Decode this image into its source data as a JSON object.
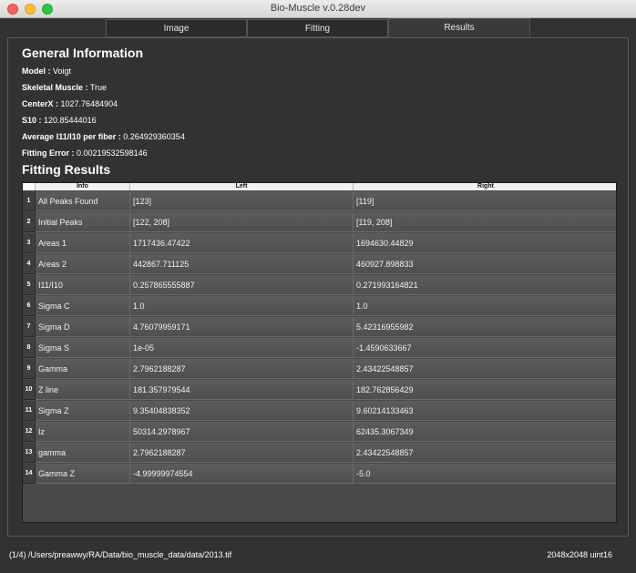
{
  "window": {
    "title": "Bio-Muscle v.0.28dev"
  },
  "tabs": [
    {
      "label": "Image"
    },
    {
      "label": "Fitting"
    },
    {
      "label": "Results"
    }
  ],
  "general": {
    "heading": "General Information",
    "model_label": "Model :",
    "model_value": "Voigt",
    "skeletal_label": "Skeletal Muscle :",
    "skeletal_value": "True",
    "centerx_label": "CenterX :",
    "centerx_value": "1027.76484904",
    "s10_label": "S10 :",
    "s10_value": "120.85444016",
    "avg_label": "Average I11/I10 per fiber :",
    "avg_value": "0.264929360354",
    "error_label": "Fitting Error :",
    "error_value": "0.00219532598146"
  },
  "fitting": {
    "heading": "Fitting Results",
    "columns": [
      "Info",
      "Left",
      "Right"
    ],
    "rows": [
      {
        "n": "1",
        "info": "All Peaks Found",
        "left": "[123]",
        "right": "[119]"
      },
      {
        "n": "2",
        "info": "Initial Peaks",
        "left": "[122, 208]",
        "right": "[119, 208]"
      },
      {
        "n": "3",
        "info": "Areas 1",
        "left": "1717436.47422",
        "right": "1694630.44829"
      },
      {
        "n": "4",
        "info": "Areas 2",
        "left": "442867.711125",
        "right": "460927.898833"
      },
      {
        "n": "5",
        "info": "I11/I10",
        "left": "0.257865555887",
        "right": "0.271993164821"
      },
      {
        "n": "6",
        "info": "Sigma C",
        "left": "1.0",
        "right": "1.0"
      },
      {
        "n": "7",
        "info": "Sigma D",
        "left": "4.76079959171",
        "right": "5.42316955982"
      },
      {
        "n": "8",
        "info": "Sigma S",
        "left": "1e-05",
        "right": "-1.4590633667"
      },
      {
        "n": "9",
        "info": "Gamma",
        "left": "2.7962188287",
        "right": "2.43422548857"
      },
      {
        "n": "10",
        "info": "Z line",
        "left": "181.357979544",
        "right": "182.762856429"
      },
      {
        "n": "11",
        "info": "Sigma Z",
        "left": "9.35404838352",
        "right": "9.60214133463"
      },
      {
        "n": "12",
        "info": "Iz",
        "left": "50314.2978967",
        "right": "62435.3067349"
      },
      {
        "n": "13",
        "info": "gamma",
        "left": "2.7962188287",
        "right": "2.43422548857"
      },
      {
        "n": "14",
        "info": "Gamma Z",
        "left": "-4.99999974554",
        "right": "-5.0"
      }
    ]
  },
  "status": {
    "left": "(1/4) /Users/preawwy/RA/Data/bio_muscle_data/data/2013.tif",
    "right": "2048x2048 uint16"
  }
}
